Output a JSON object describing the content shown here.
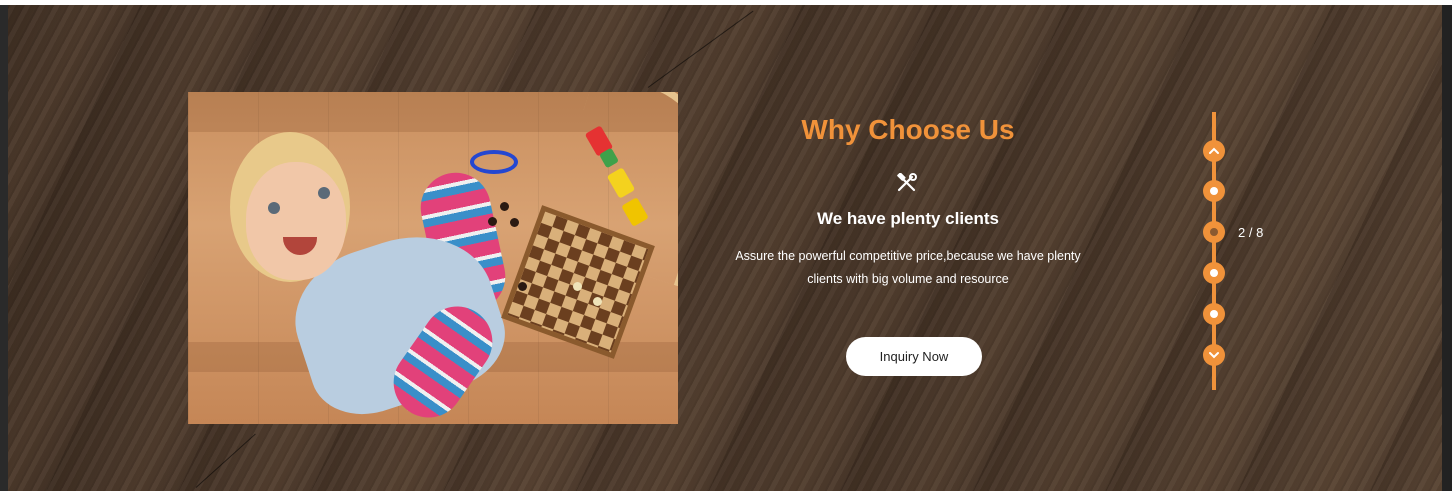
{
  "section": {
    "title": "Why Choose Us",
    "icon": "tools-icon",
    "subtitle": "We have plenty clients",
    "description_line1": "Assure the powerful competitive price,because we have plenty",
    "description_line2": "clients with big volume and resource",
    "cta_label": "Inquiry Now"
  },
  "pager": {
    "counter": "2 / 8",
    "current": 2,
    "total": 8,
    "up_icon": "chevron-up-icon",
    "down_icon": "chevron-down-icon"
  },
  "colors": {
    "accent": "#f0923a",
    "text": "#ffffff",
    "button_bg": "#ffffff",
    "background": "#4a392c"
  }
}
